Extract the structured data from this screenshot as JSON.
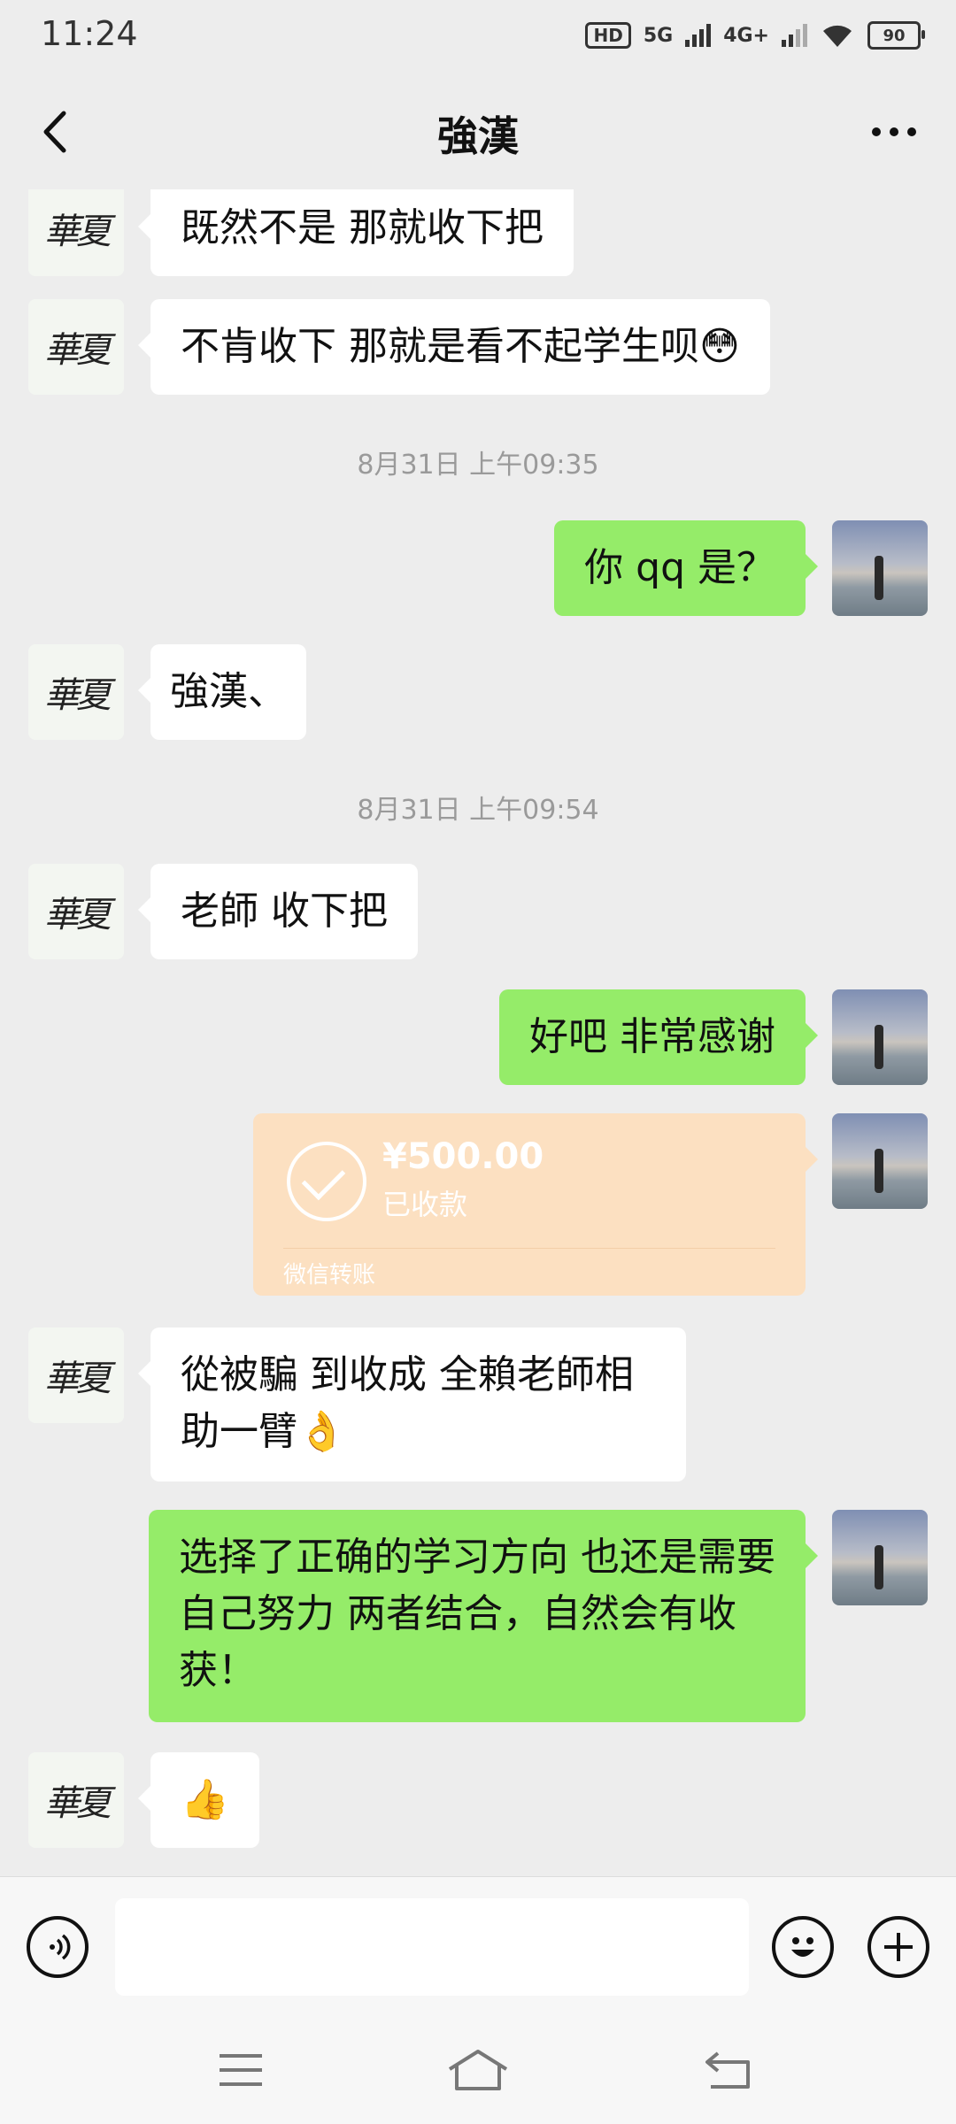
{
  "status_bar": {
    "time": "11:24",
    "hd_label": "HD",
    "sim1_net": "5G",
    "sim2_net": "4G+",
    "battery": "90"
  },
  "header": {
    "title": "強漢",
    "back_icon": "chevron-left-icon",
    "more_icon": "more-dots-icon"
  },
  "messages": [
    {
      "side": "left",
      "text": "既然不是  那就收下把"
    },
    {
      "side": "left",
      "text": "不肯收下 那就是看不起学生呗😳"
    },
    {
      "type": "timestamp",
      "text": "8月31日 上午09:35"
    },
    {
      "side": "right",
      "text": "你 qq 是？"
    },
    {
      "side": "left",
      "text": "強漢、"
    },
    {
      "type": "timestamp",
      "text": "8月31日 上午09:54"
    },
    {
      "side": "left",
      "text": "老師  收下把"
    },
    {
      "side": "right",
      "text": "好吧 非常感谢"
    },
    {
      "side": "right",
      "type": "transfer",
      "amount": "¥500.00",
      "status": "已收款",
      "footer": "微信转账"
    },
    {
      "side": "left",
      "text": "從被騙 到收成  全賴老師相助一臂👌"
    },
    {
      "side": "right",
      "text": "选择了正确的学习方向 也还是需要自己努力  两者结合，自然会有收获！"
    },
    {
      "side": "left",
      "text": "👍"
    }
  ],
  "avatars": {
    "left_text": "華夏",
    "right_desc": "beach-photo-avatar"
  },
  "input_bar": {
    "voice_icon": "voice-icon",
    "emoji_icon": "emoji-icon",
    "plus_icon": "plus-icon",
    "placeholder": ""
  },
  "nav_bar": {
    "menu_icon": "menu-icon",
    "home_icon": "home-icon",
    "back_icon": "back-nav-icon"
  }
}
